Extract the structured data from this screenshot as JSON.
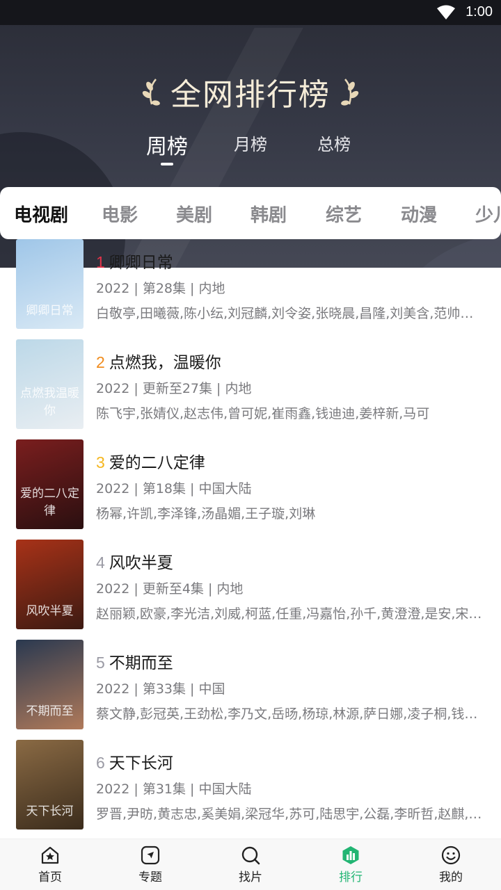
{
  "status": {
    "time": "1:00"
  },
  "header": {
    "title": "全网排行榜"
  },
  "period_tabs": [
    {
      "label": "周榜",
      "active": true
    },
    {
      "label": "月榜",
      "active": false
    },
    {
      "label": "总榜",
      "active": false
    }
  ],
  "categories": [
    {
      "label": "电视剧",
      "active": true
    },
    {
      "label": "电影"
    },
    {
      "label": "美剧"
    },
    {
      "label": "韩剧"
    },
    {
      "label": "综艺"
    },
    {
      "label": "动漫"
    },
    {
      "label": "少儿"
    }
  ],
  "items": [
    {
      "rank": "1",
      "rank_color": "#e5334b",
      "title": "卿卿日常",
      "meta": "2022 | 第28集 | 内地",
      "cast": "白敬亭,田曦薇,陈小纭,刘冠麟,刘令姿,张晓晨,昌隆,刘美含,范帅琦,…",
      "poster_label": "卿卿日常",
      "poster_colors": [
        "#9fc6e8",
        "#d9e9f5"
      ]
    },
    {
      "rank": "2",
      "rank_color": "#f08c1e",
      "title": "点燃我，温暖你",
      "meta": "2022 | 更新至27集 | 内地",
      "cast": "陈飞宇,张婧仪,赵志伟,曾可妮,崔雨鑫,钱迪迪,姜梓新,马可",
      "poster_label": "点燃我温暖你",
      "poster_colors": [
        "#bcd8e8",
        "#e9eef2"
      ]
    },
    {
      "rank": "3",
      "rank_color": "#f5b61e",
      "title": "爱的二八定律",
      "meta": "2022 | 第18集 | 中国大陆",
      "cast": "杨幂,许凯,李泽锋,汤晶媚,王子璇,刘琳",
      "poster_label": "爱的二八定律",
      "poster_colors": [
        "#7a1e1e",
        "#2a0f10"
      ]
    },
    {
      "rank": "4",
      "rank_color": "#9a9aa4",
      "title": "风吹半夏",
      "meta": "2022 | 更新至4集 | 内地",
      "cast": "赵丽颖,欧豪,李光洁,刘威,柯蓝,任重,冯嘉怡,孙千,黄澄澄,是安,宋…",
      "poster_label": "风吹半夏",
      "poster_colors": [
        "#a83218",
        "#3c1a12"
      ]
    },
    {
      "rank": "5",
      "rank_color": "#9a9aa4",
      "title": "不期而至",
      "meta": "2022 | 第33集 | 中国",
      "cast": "蔡文静,彭冠英,王劲松,李乃文,岳旸,杨琼,林源,萨日娜,凌子桐,钱…",
      "poster_label": "不期而至",
      "poster_colors": [
        "#2a3950",
        "#b07a5a"
      ]
    },
    {
      "rank": "6",
      "rank_color": "#9a9aa4",
      "title": "天下长河",
      "meta": "2022 | 第31集 | 中国大陆",
      "cast": "罗晋,尹昉,黄志忠,奚美娟,梁冠华,苏可,陆思宇,公磊,李昕哲,赵麒,…",
      "poster_label": "天下长河",
      "poster_colors": [
        "#8a6a44",
        "#3b2c1c"
      ]
    }
  ],
  "bottom_nav": [
    {
      "label": "首页",
      "icon": "home-icon",
      "active": false
    },
    {
      "label": "专题",
      "icon": "compass-icon",
      "active": false
    },
    {
      "label": "找片",
      "icon": "search-icon",
      "active": false
    },
    {
      "label": "排行",
      "icon": "ranking-icon",
      "active": true
    },
    {
      "label": "我的",
      "icon": "profile-icon",
      "active": false
    }
  ]
}
